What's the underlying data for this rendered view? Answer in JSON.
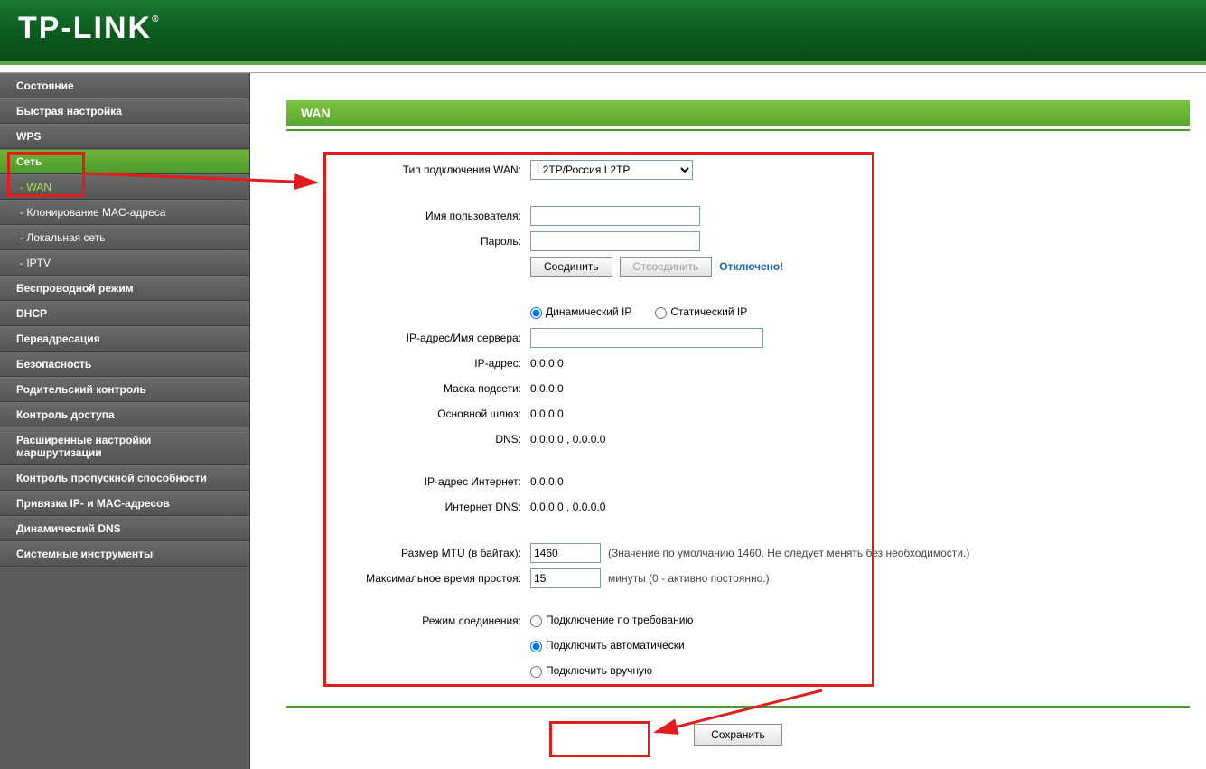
{
  "brand": "TP-LINK",
  "sidebar": {
    "items": [
      {
        "label": "Состояние",
        "type": "top"
      },
      {
        "label": "Быстрая настройка",
        "type": "top"
      },
      {
        "label": "WPS",
        "type": "top"
      },
      {
        "label": "Сеть",
        "type": "top",
        "active": true
      },
      {
        "label": "- WAN",
        "type": "sub",
        "active_sub": true
      },
      {
        "label": "- Клонирование MAC-адреса",
        "type": "sub"
      },
      {
        "label": "- Локальная сеть",
        "type": "sub"
      },
      {
        "label": "- IPTV",
        "type": "sub"
      },
      {
        "label": "Беспроводной режим",
        "type": "top"
      },
      {
        "label": "DHCP",
        "type": "top"
      },
      {
        "label": "Переадресация",
        "type": "top"
      },
      {
        "label": "Безопасность",
        "type": "top"
      },
      {
        "label": "Родительский контроль",
        "type": "top"
      },
      {
        "label": "Контроль доступа",
        "type": "top"
      },
      {
        "label": "Расширенные настройки маршрутизации",
        "type": "top"
      },
      {
        "label": "Контроль пропускной способности",
        "type": "top"
      },
      {
        "label": "Привязка IP- и MAC-адресов",
        "type": "top"
      },
      {
        "label": "Динамический DNS",
        "type": "top"
      },
      {
        "label": "Системные инструменты",
        "type": "top"
      }
    ]
  },
  "page_title": "WAN",
  "form": {
    "wan_type_label": "Тип подключения WAN:",
    "wan_type_value": "L2TP/Россия L2TP",
    "username_label": "Имя пользователя:",
    "password_label": "Пароль:",
    "connect_btn": "Соединить",
    "disconnect_btn": "Отсоединить",
    "status": "Отключено!",
    "dyn_ip": "Динамический IP",
    "stat_ip": "Статический IP",
    "server_label": "IP-адрес/Имя сервера:",
    "ip_label": "IP-адрес:",
    "ip_value": "0.0.0.0",
    "mask_label": "Маска подсети:",
    "mask_value": "0.0.0.0",
    "gw_label": "Основной шлюз:",
    "gw_value": "0.0.0.0",
    "dns_label": "DNS:",
    "dns_value": "0.0.0.0 , 0.0.0.0",
    "inet_ip_label": "IP-адрес Интернет:",
    "inet_ip_value": "0.0.0.0",
    "inet_dns_label": "Интернет DNS:",
    "inet_dns_value": "0.0.0.0 , 0.0.0.0",
    "mtu_label": "Размер MTU (в байтах):",
    "mtu_value": "1460",
    "mtu_note": "(Значение по умолчанию 1460. Не следует менять без необходимости.)",
    "idle_label": "Максимальное время простоя:",
    "idle_value": "15",
    "idle_note": "минуты (0 - активно постоянно.)",
    "mode_label": "Режим соединения:",
    "mode_demand": "Подключение по требованию",
    "mode_auto": "Подключить автоматически",
    "mode_manual": "Подключить вручную",
    "save": "Сохранить"
  }
}
